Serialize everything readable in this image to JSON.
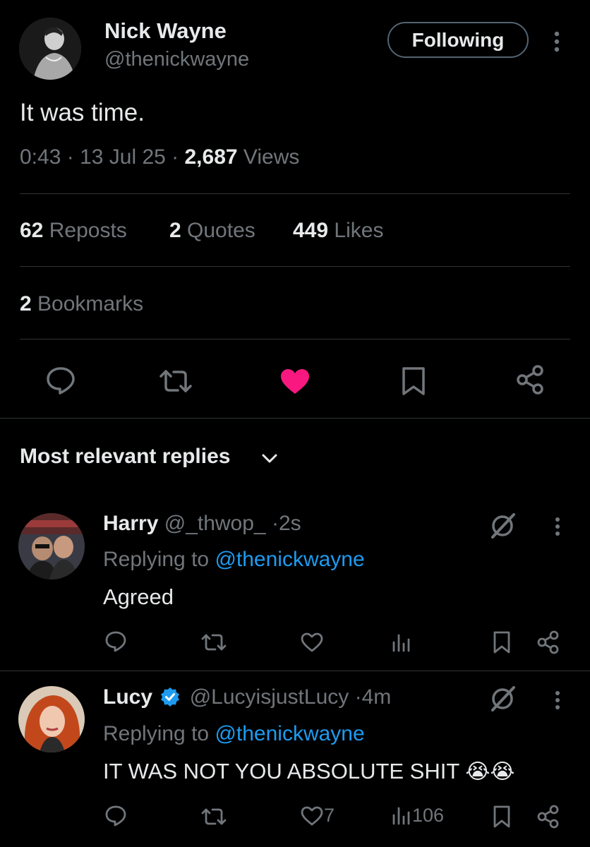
{
  "tweet": {
    "author_name": "Nick Wayne",
    "author_handle": "@thenickwayne",
    "follow_button": "Following",
    "text": "It was time.",
    "time": "0:43",
    "date": "13 Jul 25",
    "views_count": "2,687",
    "views_label": "Views",
    "reposts_count": "62",
    "reposts_label": "Reposts",
    "quotes_count": "2",
    "quotes_label": "Quotes",
    "likes_count": "449",
    "likes_label": "Likes",
    "bookmarks_count": "2",
    "bookmarks_label": "Bookmarks"
  },
  "replies_header": "Most relevant replies",
  "replies": [
    {
      "name": "Harry",
      "handle": "@_thwop_",
      "time": "2s",
      "replying_prefix": "Replying to",
      "replying_handle": "@thenickwayne",
      "text": "Agreed",
      "likes": "",
      "views": ""
    },
    {
      "name": "Lucy",
      "handle": "@LucyisjustLucy",
      "time": "4m",
      "replying_prefix": "Replying to",
      "replying_handle": "@thenickwayne",
      "text": "IT WAS NOT YOU ABSOLUTE SHIT",
      "emoji": "😭😭",
      "likes": "7",
      "views": "106"
    }
  ],
  "colors": {
    "background": "#000000",
    "text": "#e7e9ea",
    "secondary": "#71767b",
    "accent": "#1d9bf0",
    "like": "#f91880",
    "divider": "#2f3336"
  }
}
